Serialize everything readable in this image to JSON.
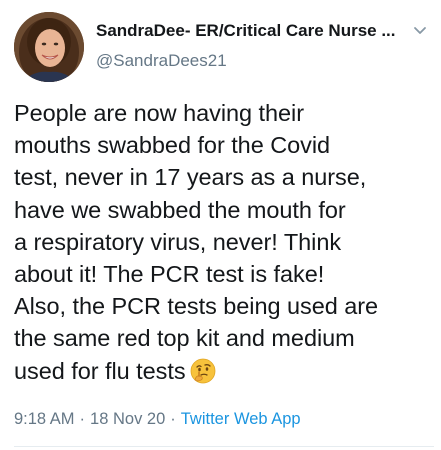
{
  "user": {
    "display_name": "SandraDee- ER/Critical Care Nurse ...",
    "handle": "@SandraDees21",
    "avatar_icon": "profile-photo"
  },
  "tweet": {
    "lines": [
      "People are now having their",
      "mouths swabbed for the Covid",
      "test, never in 17 years as a nurse,",
      "have we swabbed the mouth for",
      "a respiratory virus, never! Think",
      "about it! The PCR test is fake!",
      "Also, the PCR tests being used are",
      "the same red top kit and medium",
      "used for flu tests"
    ],
    "emoji": "thinking-face-emoji"
  },
  "meta": {
    "time": "9:18 AM",
    "date": "18 Nov 20",
    "source": "Twitter Web App",
    "separator": "·"
  },
  "colors": {
    "text": "#14171a",
    "secondary": "#657786",
    "link": "#1b95e0",
    "divider": "#e6ecf0"
  },
  "icons": {
    "menu": "chevron-down-icon"
  }
}
